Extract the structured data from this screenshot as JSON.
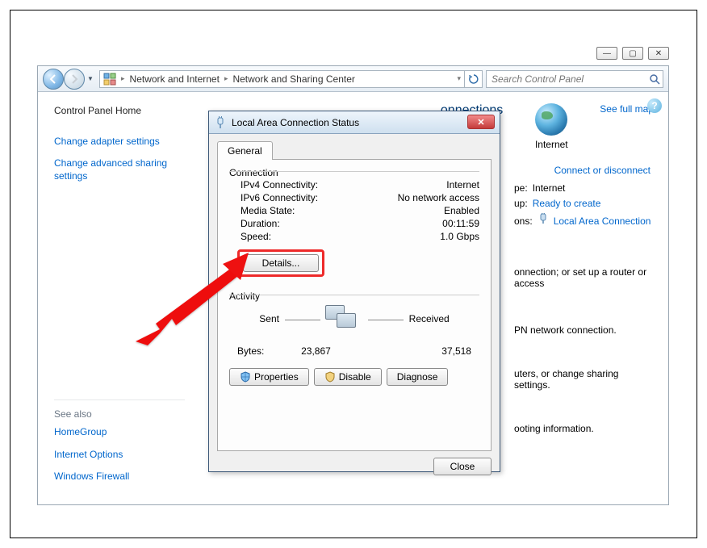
{
  "window_buttons": {
    "min": "—",
    "max": "▢",
    "close": "✕"
  },
  "breadcrumb": {
    "items": [
      "Network and Internet",
      "Network and Sharing Center"
    ],
    "search_placeholder": "Search Control Panel"
  },
  "left_pane": {
    "home": "Control Panel Home",
    "links": [
      "Change adapter settings",
      "Change advanced sharing settings"
    ],
    "see_also_label": "See also",
    "see_also": [
      "HomeGroup",
      "Internet Options",
      "Windows Firewall"
    ]
  },
  "right_pane": {
    "title_suffix": "onnections",
    "see_map": "See full map",
    "internet_label": "Internet",
    "connect_link": "Connect or disconnect",
    "rows": [
      {
        "k": "pe:",
        "v": "Internet"
      },
      {
        "k": "up:",
        "v": "Ready to create"
      },
      {
        "k": "ons:",
        "v": "Local Area Connection"
      }
    ],
    "frag1": "onnection; or set up a router or access",
    "frag2": "PN network connection.",
    "frag3": "uters, or change sharing settings.",
    "frag4": "ooting information."
  },
  "dialog": {
    "title": "Local Area Connection Status",
    "tab": "General",
    "group_conn": "Connection",
    "conn": [
      {
        "k": "IPv4 Connectivity:",
        "v": "Internet"
      },
      {
        "k": "IPv6 Connectivity:",
        "v": "No network access"
      },
      {
        "k": "Media State:",
        "v": "Enabled"
      },
      {
        "k": "Duration:",
        "v": "00:11:59"
      },
      {
        "k": "Speed:",
        "v": "1.0 Gbps"
      }
    ],
    "details_btn": "Details...",
    "group_act": "Activity",
    "sent": "Sent",
    "received": "Received",
    "bytes_label": "Bytes:",
    "bytes_sent": "23,867",
    "bytes_recv": "37,518",
    "btn_properties": "Properties",
    "btn_disable": "Disable",
    "btn_diagnose": "Diagnose",
    "btn_close": "Close"
  }
}
